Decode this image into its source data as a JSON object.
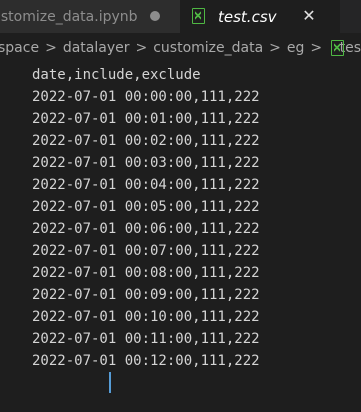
{
  "tabs": [
    {
      "label": "ustomize_data.ipynb",
      "state": "inactive",
      "modified": true
    },
    {
      "label": "test.csv",
      "state": "active",
      "icon": "csv-file-icon"
    }
  ],
  "breadcrumb": {
    "items": [
      "space",
      "datalayer",
      "customize_data",
      "eg",
      "tes"
    ],
    "separator": ">"
  },
  "editor": {
    "lines": [
      "date,include,exclude",
      "2022-07-01 00:00:00,111,222",
      "2022-07-01 00:01:00,111,222",
      "2022-07-01 00:02:00,111,222",
      "2022-07-01 00:03:00,111,222",
      "2022-07-01 00:04:00,111,222",
      "2022-07-01 00:05:00,111,222",
      "2022-07-01 00:06:00,111,222",
      "2022-07-01 00:07:00,111,222",
      "2022-07-01 00:08:00,111,222",
      "2022-07-01 00:09:00,111,222",
      "2022-07-01 00:10:00,111,222",
      "2022-07-01 00:11:00,111,222",
      "2022-07-01 00:12:00,111,222"
    ]
  },
  "colors": {
    "background": "#1e1e1e",
    "csv_icon": "#4fb843",
    "cursor": "#569cd6"
  }
}
